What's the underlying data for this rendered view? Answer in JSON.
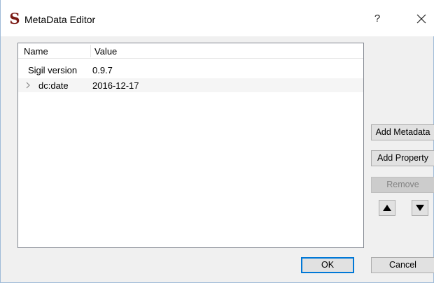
{
  "window": {
    "title": "MetaData Editor",
    "app_icon_glyph": "S",
    "help_label": "?",
    "accent_color": "#0078d7"
  },
  "table": {
    "columns": [
      "Name",
      "Value"
    ],
    "rows": [
      {
        "name": "Sigil version",
        "value": "0.9.7",
        "expandable": false
      },
      {
        "name": "dc:date",
        "value": "2016-12-17",
        "expandable": true
      }
    ]
  },
  "side_buttons": {
    "add_metadata": "Add Metadata",
    "add_property": "Add Property",
    "remove": "Remove",
    "move_up_icon": "triangle-up-icon",
    "move_down_icon": "triangle-down-icon"
  },
  "footer": {
    "ok": "OK",
    "cancel": "Cancel"
  }
}
